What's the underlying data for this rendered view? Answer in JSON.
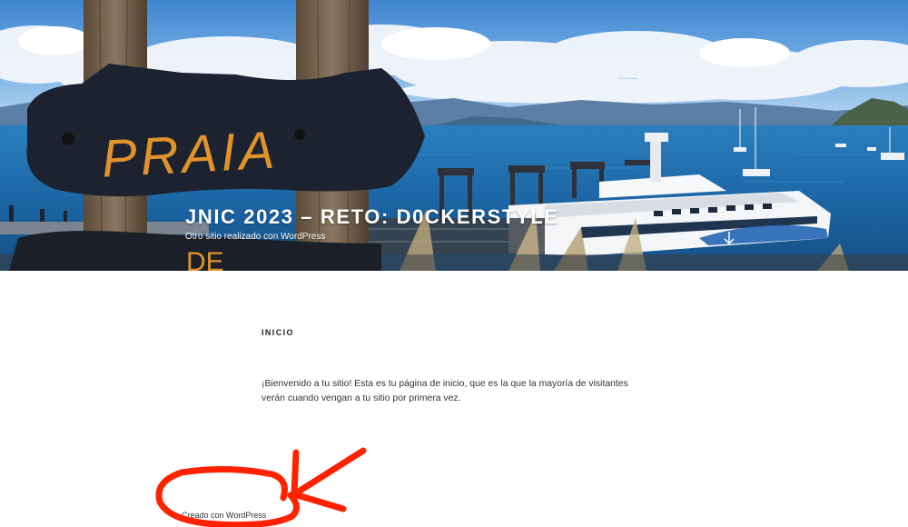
{
  "header": {
    "site_title": "JNIC 2023 – RETO: D0CKERSTYLE",
    "site_description": "Otro sitio realizado con WordPress",
    "sign_text": "PRAIA",
    "sign_text_lower": "DE",
    "scroll_icon": "arrow-down-icon"
  },
  "main": {
    "page_title": "INICIO",
    "welcome_text": "¡Bienvenido a tu sitio! Esta es tu página de inicio, que es la que la mayoría de visitantes verán cuando vengan a tu sitio por primera vez."
  },
  "footer": {
    "credit_text": "Creado con WordPress"
  },
  "colors": {
    "annotation": "#ff2200",
    "sea": "#1d6fae",
    "sky": "#4a8fd3",
    "sign": "#1c2230",
    "sign_letters": "#e0932b"
  }
}
